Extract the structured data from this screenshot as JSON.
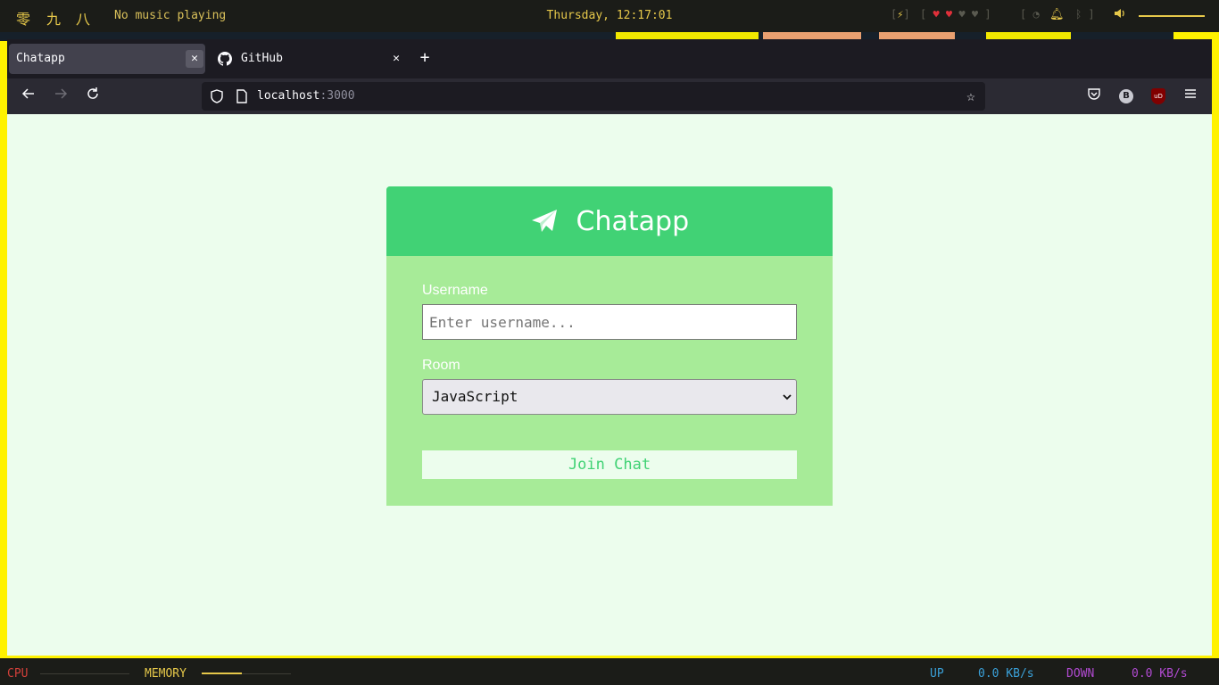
{
  "topbar": {
    "workspaces": [
      "零",
      "九",
      "八"
    ],
    "music": "No music playing",
    "clock": "Thursday, 12:17:01",
    "volume_level": 1.0
  },
  "browser": {
    "tabs": [
      {
        "title": "Chatapp",
        "active": true
      },
      {
        "title": "GitHub",
        "active": false
      }
    ],
    "url_host": "localhost",
    "url_port": ":3000",
    "extension_badge": "B",
    "ublock_label": "uD"
  },
  "page": {
    "app_title": "Chatapp",
    "username_label": "Username",
    "username_placeholder": "Enter username...",
    "username_value": "",
    "room_label": "Room",
    "room_selected": "JavaScript",
    "join_button": "Join Chat"
  },
  "bottombar": {
    "cpu_label": "CPU",
    "cpu_level": 0.0,
    "memory_label": "MEMORY",
    "memory_level": 0.45,
    "up_label": "UP",
    "up_value": "0.0 KB/s",
    "down_label": "DOWN",
    "down_value": "0.0 KB/s"
  },
  "colors": {
    "accent_yellow": "#e6c84a",
    "header_green": "#41d275",
    "card_green": "#a7eb98",
    "page_bg": "#ecfded"
  }
}
